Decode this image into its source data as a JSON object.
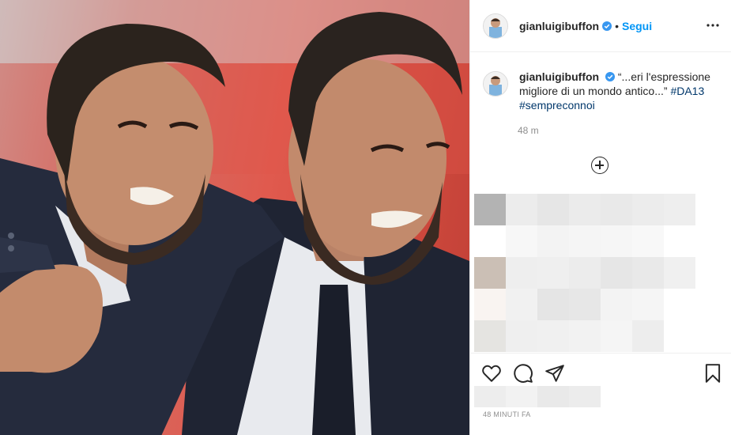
{
  "header": {
    "username": "gianluigibuffon",
    "separator": "•",
    "follow_label": "Segui"
  },
  "caption": {
    "username": "gianluigibuffon",
    "text": "“...eri l'espressione migliore di un mondo antico...”",
    "hashtags": [
      "#DA13",
      "#sempreconnoi"
    ],
    "time": "48 m"
  },
  "footer": {
    "posted_ago": "48 MINUTI FA"
  },
  "icons": {
    "verified": "verified-badge-icon",
    "more": "more-options-icon",
    "add_comment": "plus-circle-icon",
    "like": "heart-icon",
    "comment": "comment-bubble-icon",
    "share": "paper-plane-icon",
    "save": "bookmark-icon"
  },
  "colors": {
    "accent": "#0095f6",
    "hashtag": "#00376b",
    "muted": "#8e8e8e"
  }
}
